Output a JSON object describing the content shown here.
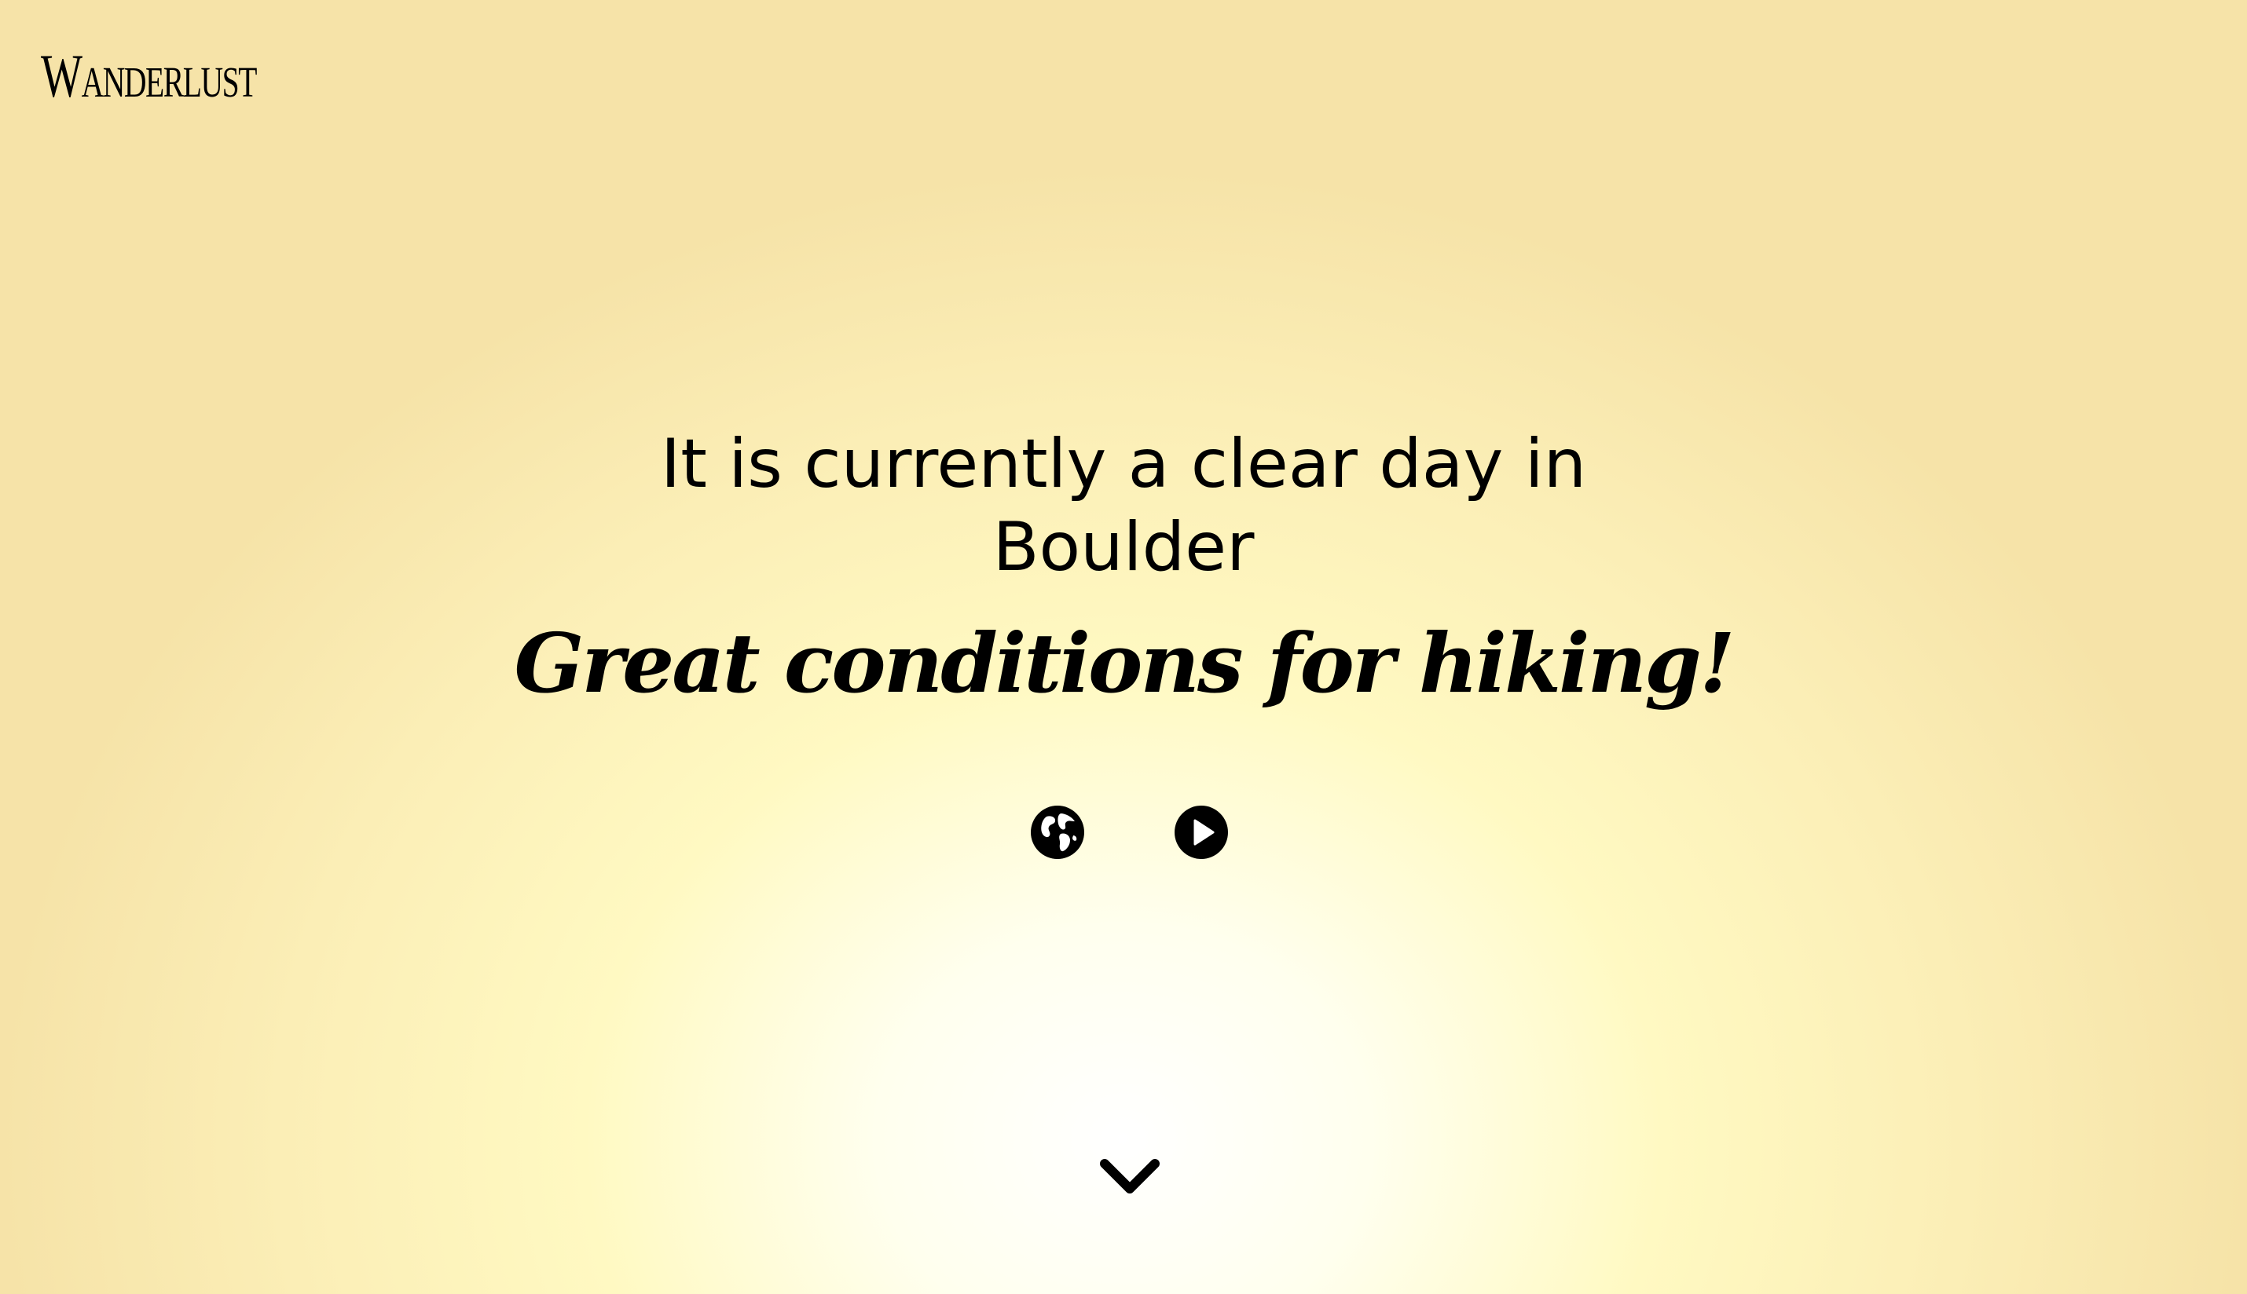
{
  "brand": {
    "name": "Wanderlust"
  },
  "weather": {
    "line1": "It is currently a clear day in",
    "line2": "Boulder"
  },
  "tagline": "Great conditions for hiking!",
  "icons": {
    "globe": "globe-icon",
    "play": "play-icon",
    "scroll": "chevron-down-icon"
  },
  "colors": {
    "text": "#000000",
    "background_center": "#ffffff",
    "background_edge": "#f6e3a8"
  }
}
